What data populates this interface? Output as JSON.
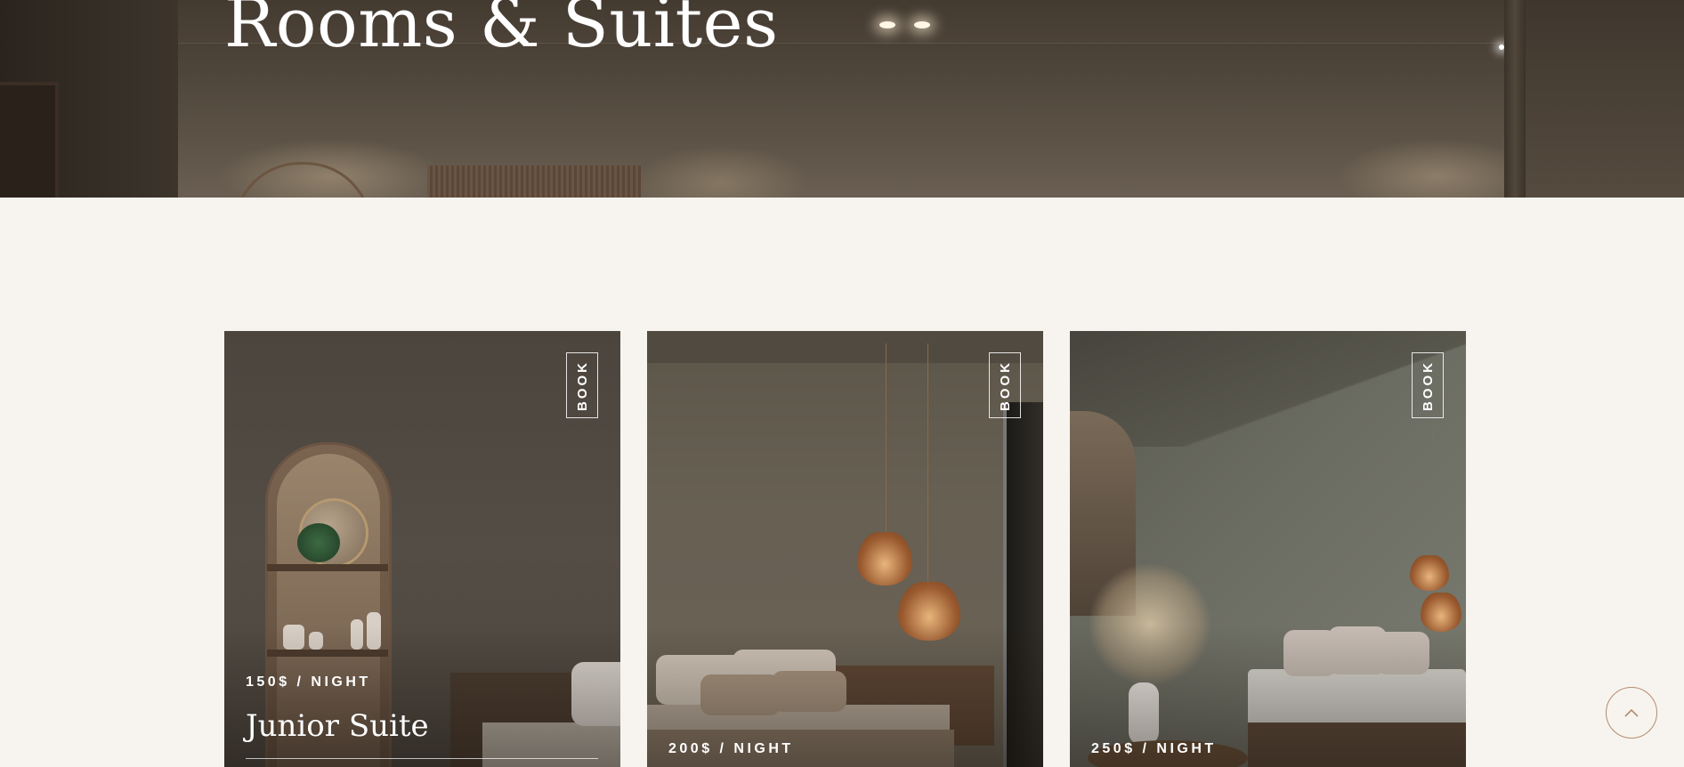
{
  "hero": {
    "title": "Rooms & Suites"
  },
  "rooms": [
    {
      "name": "Junior Suite",
      "price": "150$ / NIGHT",
      "book_label": "BOOK"
    },
    {
      "price": "200$ / NIGHT",
      "book_label": "BOOK"
    },
    {
      "price": "250$ / NIGHT",
      "book_label": "BOOK"
    }
  ],
  "colors": {
    "page_background": "#f7f4ef",
    "accent": "#b38c6e",
    "text_on_image": "#ffffff"
  },
  "icons": {
    "scroll_top": "chevron-up-icon"
  }
}
